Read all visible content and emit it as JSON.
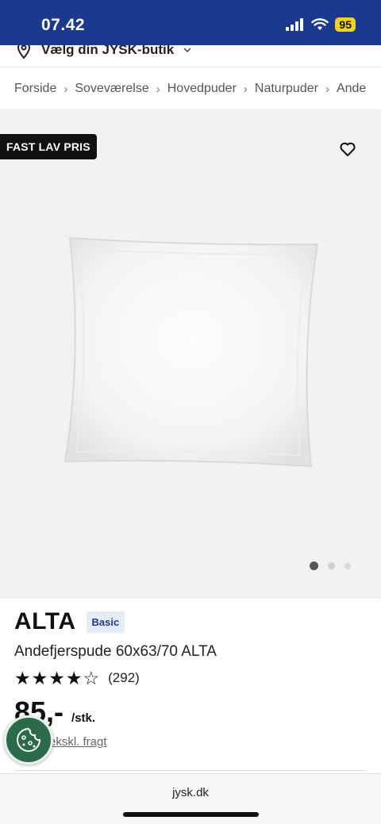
{
  "status_bar": {
    "time": "07.42",
    "battery": "95"
  },
  "store": {
    "label": "Vælg din JYSK-butik"
  },
  "breadcrumb": {
    "items": [
      "Forside",
      "Soveværelse",
      "Hovedpuder",
      "Naturpuder",
      "Ande"
    ]
  },
  "gallery": {
    "badge": "FAST LAV PRIS",
    "image_count": 3,
    "active_index": 0
  },
  "product": {
    "brand": "ALTA",
    "tag": "Basic",
    "name": "Andefjerspude 60x63/70 ALTA",
    "rating_stars": 4,
    "rating_max": 5,
    "rating_count": "(292)",
    "price": "85,-",
    "unit": "/stk.",
    "shipping": "ekskl. fragt"
  },
  "browser": {
    "url": "jysk.dk"
  },
  "colors": {
    "brand_blue": "#1b3a8f",
    "cookie_green": "#2c6b4a",
    "badge_black": "#111111"
  }
}
